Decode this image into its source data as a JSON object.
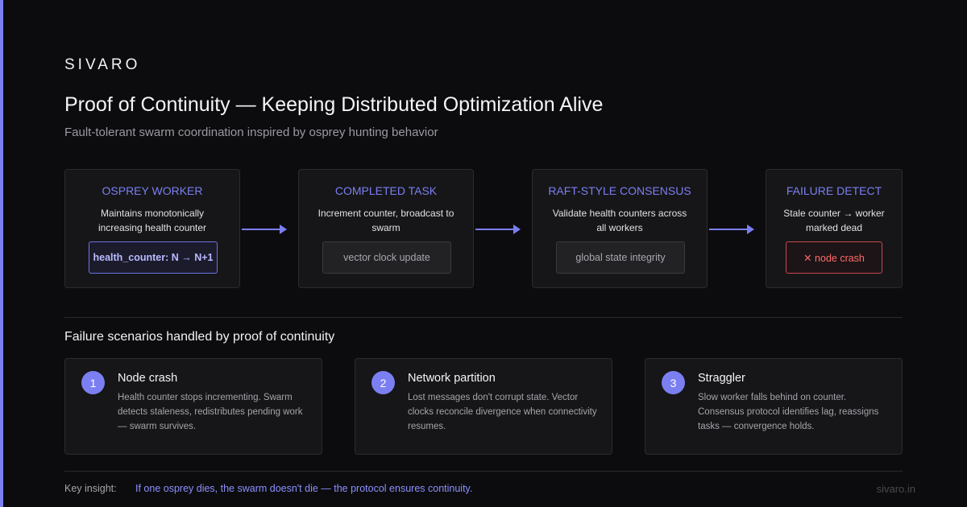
{
  "brand": {
    "logo": "SIVARO",
    "accent": "#7b7ff2"
  },
  "header": {
    "title": "Proof of Continuity — Keeping Distributed Optimization Alive",
    "subtitle": "Fault-tolerant swarm coordination inspired by osprey hunting behavior"
  },
  "pipeline": [
    {
      "title": "OSPREY WORKER",
      "desc": "Maintains monotonically increasing health counter",
      "chip": "health_counter: N → N+1"
    },
    {
      "title": "COMPLETED TASK",
      "desc": "Increment counter, broadcast to swarm",
      "chip": "vector clock update"
    },
    {
      "title": "RAFT-STYLE CONSENSUS",
      "desc": "Validate health counters across all workers",
      "chip": "global state integrity"
    },
    {
      "title": "FAILURE DETECT",
      "desc": "Stale counter → worker marked dead",
      "chip": "✕ node crash"
    }
  ],
  "scenarios": {
    "title": "Failure scenarios handled by proof of continuity",
    "items": [
      {
        "num": "1",
        "title": "Node crash",
        "text": "Health counter stops incrementing. Swarm detects staleness, redistributes pending work — swarm survives."
      },
      {
        "num": "2",
        "title": "Network partition",
        "text": "Lost messages don't corrupt state. Vector clocks reconcile divergence when connectivity resumes."
      },
      {
        "num": "3",
        "title": "Straggler",
        "text": "Slow worker falls behind on counter. Consensus protocol identifies lag, reassigns tasks — convergence holds."
      }
    ]
  },
  "footer": {
    "label": "Key insight:",
    "insight": "If one osprey dies, the swarm doesn't die — the protocol ensures continuity.",
    "site": "sivaro.in"
  }
}
